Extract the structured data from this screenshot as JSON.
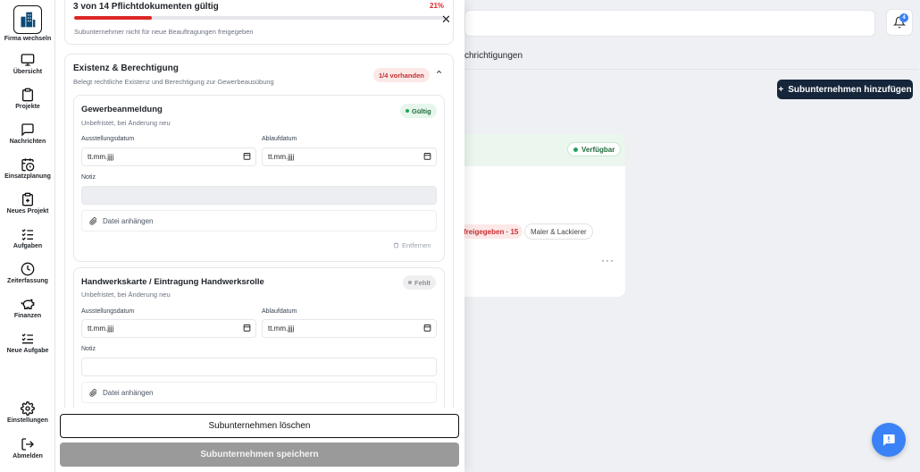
{
  "sidebar": {
    "items": [
      {
        "label": "Firma wechseln",
        "icon": "building-icon"
      },
      {
        "label": "Übersicht",
        "icon": "monitor-icon"
      },
      {
        "label": "Projekte",
        "icon": "clipboard-icon"
      },
      {
        "label": "Nachrichten",
        "icon": "message-icon"
      },
      {
        "label": "Einsatzplanung",
        "icon": "calendar-clock-icon"
      },
      {
        "label": "Neues Projekt",
        "icon": "clipboard-plus-icon"
      },
      {
        "label": "Aufgaben",
        "icon": "checklist-icon"
      },
      {
        "label": "Zeiterfassung",
        "icon": "clock-icon"
      },
      {
        "label": "Finanzen",
        "icon": "piggy-bank-icon"
      },
      {
        "label": "Neue Aufgabe",
        "icon": "list-plus-icon"
      },
      {
        "label": "Einstellungen",
        "icon": "gear-icon"
      },
      {
        "label": "Abmelden",
        "icon": "logout-icon"
      }
    ]
  },
  "background": {
    "notification_count": "4",
    "tab_label": "chrichtigungen",
    "add_button_label": "Subunternehmen hinzufügen",
    "card_status": "Verfügbar",
    "chip_red": "freigegeben · 15",
    "chip_grey": "Maler & Lackierer",
    "more_label": "···"
  },
  "summary": {
    "title": "3 von 14 Pflichtdokumenten gültig",
    "percent_label": "21%",
    "progress": 0.21,
    "subtitle": "Subunternehmer nicht für neue Beauftragungen freigegeben"
  },
  "section": {
    "title": "Existenz & Berechtigung",
    "subtitle": "Belegt rechtliche Existenz und Berechtigung zur Gewerbeausübung",
    "badge": "1/4 vorhanden"
  },
  "documents": [
    {
      "title": "Gewerbeanmeldung",
      "subtitle": "Unbefristet, bei Änderung neu",
      "status": "Gültig",
      "issue_label": "Ausstellungsdatum",
      "issue_value": "tt.mm.jjjj",
      "expiry_label": "Ablaufdatum",
      "expiry_value": "tt.mm.jjjj",
      "note_label": "Notiz",
      "attach_label": "Datei anhängen",
      "remove_label": "Entfernen"
    },
    {
      "title": "Handwerkskarte / Eintragung Handwerksrolle",
      "subtitle": "Unbefristet, bei Änderung neu",
      "status": "Fehlt",
      "issue_label": "Ausstellungsdatum",
      "issue_value": "tt.mm.jjjj",
      "expiry_label": "Ablaufdatum",
      "expiry_value": "tt.mm.jjjj",
      "note_label": "Notiz",
      "attach_label": "Datei anhängen"
    }
  ],
  "footer": {
    "delete_label": "Subunternehmen löschen",
    "save_label": "Subunternehmen speichern"
  },
  "colors": {
    "danger": "#dc2626",
    "success": "#22a55a",
    "primary_dark": "#15253a",
    "accent_blue": "#3b82f6"
  }
}
